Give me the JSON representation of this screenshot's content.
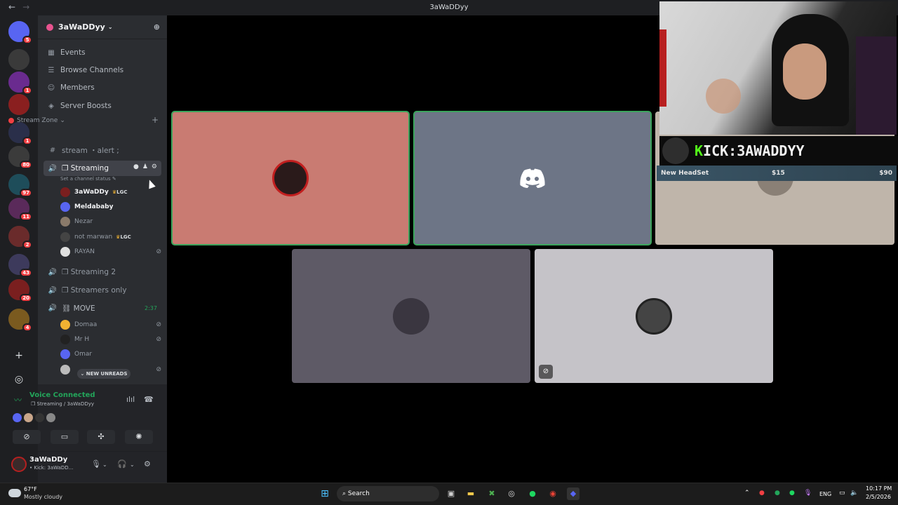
{
  "window": {
    "title": "3aWaDDyy",
    "back": "←",
    "forward": "→"
  },
  "guilds": [
    {
      "color": "#5865f2",
      "badge": "5",
      "icon": "discord-home-icon"
    },
    {
      "color": "#3a3a3a",
      "badge": "",
      "icon": "server-icon"
    },
    {
      "color": "#6a2b8f",
      "badge": "1",
      "icon": "server-icon"
    },
    {
      "color": "#8a1f1f",
      "badge": "",
      "icon": "server-icon"
    },
    {
      "color": "#2a2f4a",
      "badge": "1",
      "icon": "server-icon"
    },
    {
      "color": "#3b3b3b",
      "badge": "80",
      "icon": "server-icon"
    },
    {
      "color": "#1e4d5a",
      "badge": "97",
      "icon": "server-icon"
    },
    {
      "color": "#5a2a5a",
      "badge": "11",
      "icon": "server-icon"
    },
    {
      "color": "#6a2b2b",
      "badge": "2",
      "icon": "server-icon"
    },
    {
      "color": "#3d3a5c",
      "badge": "43",
      "icon": "server-icon"
    },
    {
      "color": "#7a1f1f",
      "badge": "20",
      "icon": "server-icon"
    },
    {
      "color": "#7a5a1f",
      "badge": "4",
      "icon": "server-icon"
    }
  ],
  "server": {
    "name": "3aWaDDyy",
    "menu": [
      {
        "label": "Events",
        "icon": "▦"
      },
      {
        "label": "Browse Channels",
        "icon": "☰"
      },
      {
        "label": "Members",
        "icon": "☺"
      },
      {
        "label": "Server Boosts",
        "icon": "◈"
      }
    ],
    "category": "Stream Zone",
    "text_channel": "stream ・alert ;",
    "active_channel": {
      "name": "❐ Streaming",
      "status": "Set a channel status"
    },
    "streaming_members": [
      {
        "name": "3aWaDDy",
        "tag": "LGC",
        "color": "#7a1f1f",
        "bright": true,
        "muted": false
      },
      {
        "name": "Meldababy",
        "tag": "",
        "color": "#5865f2",
        "bright": true,
        "muted": false
      },
      {
        "name": "Nezar",
        "tag": "",
        "color": "#8a7a6a",
        "bright": false,
        "muted": false
      },
      {
        "name": "not marwan",
        "tag": "LGC",
        "color": "#444444",
        "bright": false,
        "muted": false
      },
      {
        "name": "RAYAN",
        "tag": "",
        "color": "#e0e0e0",
        "bright": false,
        "muted": true
      }
    ],
    "channels_after": [
      {
        "name": "❐ Streaming 2",
        "icon": "🔊"
      },
      {
        "name": "❐ Streamers only",
        "icon": "🔊"
      }
    ],
    "move_channel": {
      "name": "⛓ MOVE",
      "timer": "2:37"
    },
    "move_members": [
      {
        "name": "Domaa",
        "color": "#f0b232",
        "muted": true
      },
      {
        "name": "Mr H",
        "color": "#222222",
        "muted": true
      },
      {
        "name": "Omar",
        "color": "#5865f2",
        "muted": false
      },
      {
        "name": "",
        "color": "#bbbbbb",
        "muted": true
      }
    ],
    "new_unreads": "NEW UNREADS"
  },
  "voice": {
    "status": "Voice Connected",
    "sub": "❐ Streaming / 3aWaDDyy"
  },
  "user": {
    "name": "3aWaDDy",
    "status": "• Kick: 3aWaDD..."
  },
  "stream_overlay": {
    "kick_prefix": "K",
    "kick_text": "ICK:3AWADDYY",
    "goal_label": "New HeadSet",
    "goal_current": "$15",
    "goal_target": "$90"
  },
  "tiles": [
    {
      "color": "#c97b72",
      "speaking": true,
      "avatar": "#2a1a1a"
    },
    {
      "color": "#6d7586",
      "speaking": true,
      "avatar": "discord"
    },
    {
      "color": "#bfb5aa",
      "speaking": false,
      "avatar": "#8a8076"
    },
    {
      "color": "#5e5a66",
      "speaking": false,
      "avatar": "#3a3640"
    },
    {
      "color": "#c5c3c8",
      "speaking": false,
      "avatar": "#444444"
    }
  ],
  "taskbar": {
    "weather_temp": "67°F",
    "weather_desc": "Mostly cloudy",
    "search": "Search",
    "lang": "ENG",
    "time": "10:17 PM",
    "date": "2/5/2026"
  }
}
